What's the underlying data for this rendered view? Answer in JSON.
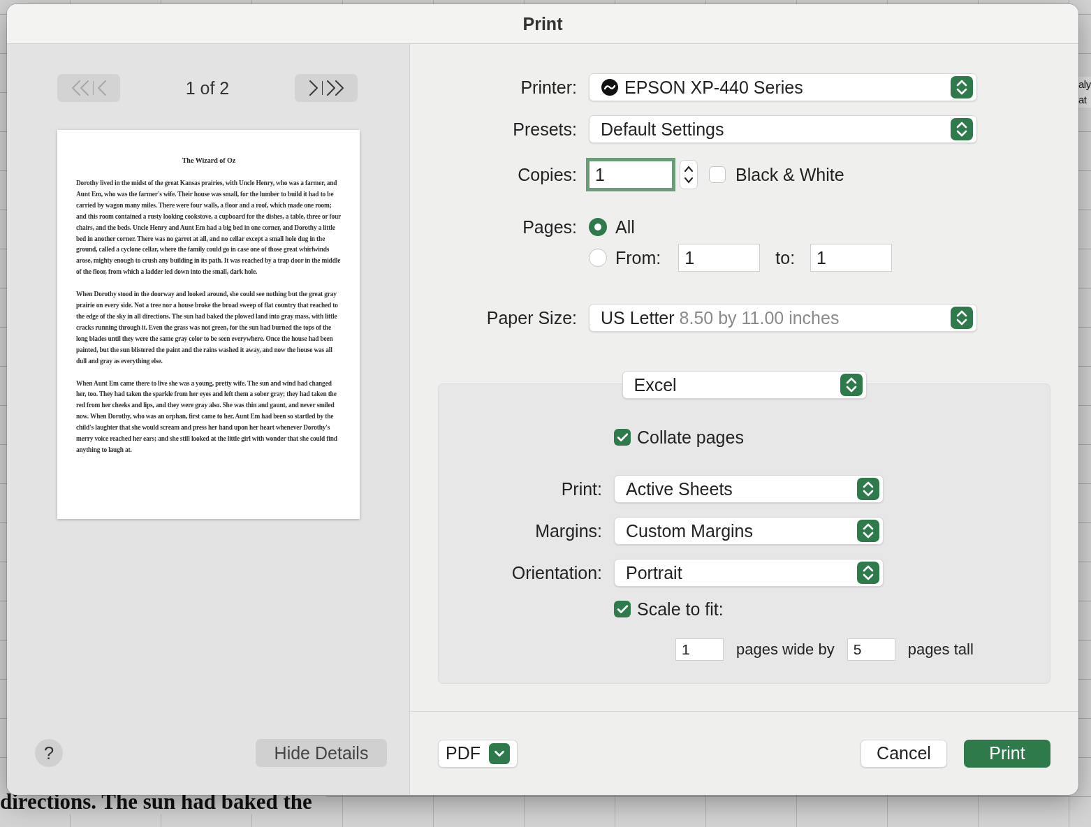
{
  "window": {
    "title": "Print"
  },
  "preview": {
    "nav": [
      {
        "kind": "back",
        "disabled": true
      },
      {
        "kind": "forward",
        "disabled": false
      }
    ],
    "page_indicator": "1 of 2",
    "page": {
      "title": "The Wizard of Oz",
      "paragraphs": [
        "Dorothy lived in the midst of the great Kansas prairies, with Uncle Henry, who was a farmer, and Aunt Em, who was the farmer's wife. Their house was small, for the lumber to build it had to be carried by wagon many miles. There were four walls, a floor and a roof, which made one room; and this room contained a rusty looking cookstove, a cupboard for the dishes, a table, three or four chairs, and the beds. Uncle Henry and Aunt Em had a big bed in one corner, and Dorothy a little bed in another corner. There was no garret at all, and no cellar except a small hole dug in the ground, called a cyclone cellar, where the family could go in case one of those great whirlwinds arose, mighty enough to crush any building in its path. It was reached by a trap door in the middle of the floor, from which a ladder led down into the small, dark hole.",
        "When Dorothy stood in the doorway and looked around, she could see nothing but the great gray prairie on every side. Not a tree nor a house broke the broad sweep of flat country that reached to the edge of the sky in all directions. The sun had baked the plowed land into gray mass, with little cracks running through it. Even the grass was not green, for the sun had burned the tops of the long blades until they were the same gray color to be seen everywhere. Once the house had been painted, but the sun blistered the paint and the rains washed it away, and now the house was all dull and gray as everything else.",
        "When Aunt Em came there to live she was a young, pretty wife. The sun and wind had changed her, too. They had taken the sparkle from her eyes and left them a sober gray; they had taken the red from her cheeks and lips, and they were gray also. She was thin and gaunt, and never smiled now. When Dorothy, who was an orphan, first came to her, Aunt Em had been so startled by the child's laughter that she would scream and press her hand upon her heart whenever Dorothy's merry voice reached her ears; and she still looked at the little girl with wonder that she could find anything to laugh at."
      ]
    }
  },
  "settings": {
    "printer": {
      "label": "Printer:",
      "value": "EPSON XP-440 Series"
    },
    "presets": {
      "label": "Presets:",
      "value": "Default Settings"
    },
    "copies": {
      "label": "Copies:",
      "value": "1"
    },
    "black_white": {
      "label": "Black & White",
      "checked": false
    },
    "pages": {
      "label": "Pages:",
      "options": [
        {
          "label": "All",
          "selected": true
        },
        {
          "label": "From:",
          "selected": false
        }
      ],
      "from": "1",
      "to_label": "to:",
      "to": "1"
    },
    "paper_size": {
      "label": "Paper Size:",
      "value": "US Letter",
      "detail": "8.50 by 11.00 inches"
    }
  },
  "app_section": {
    "value": "Excel",
    "collate": {
      "label": "Collate pages",
      "checked": true
    },
    "fields": [
      {
        "label": "Print:",
        "value": "Active Sheets"
      },
      {
        "label": "Margins:",
        "value": "Custom Margins"
      },
      {
        "label": "Orientation:",
        "value": "Portrait"
      }
    ],
    "scale": {
      "label": "Scale to fit:",
      "checked": true,
      "wide": "1",
      "wide_label": "pages wide by",
      "tall": "5",
      "tall_label": "pages tall"
    }
  },
  "footer": {
    "help": "?",
    "hide_details": "Hide Details",
    "pdf": "PDF",
    "cancel": "Cancel",
    "print": "Print"
  },
  "background": {
    "document_text": "directions. The sun had baked the",
    "ribbon_texts": [
      "aly",
      "at"
    ]
  }
}
